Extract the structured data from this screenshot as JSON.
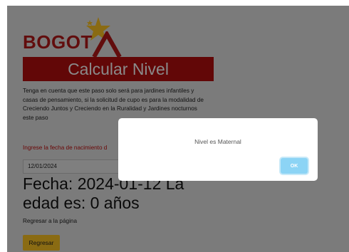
{
  "logo": {
    "text": "BOGOT",
    "icon": "star-icon"
  },
  "title": "Calcular Nivel",
  "intro_text": "Tenga en cuenta que este paso solo será para jardines infantiles y casas de pensamiento, si la solicitud de cupo es para la modalidad de Creciendo Juntos y Creciendo en la Ruralidad y Jardines nocturnos",
  "intro_text_tail": "este paso",
  "date_prompt": "Ingrese la fecha de nacimiento d",
  "date_value": "12/01/2024",
  "result_text": "Fecha: 2024-01-12 La edad es: 0 años",
  "return_label": "Regresar a la página",
  "return_button": "Regresar",
  "modal": {
    "message": "Nivel es Maternal",
    "ok_label": "OK"
  },
  "colors": {
    "brand": "#8b0f0f",
    "ok_button": "#8cd4f5",
    "return_button": "#8a6b13"
  }
}
